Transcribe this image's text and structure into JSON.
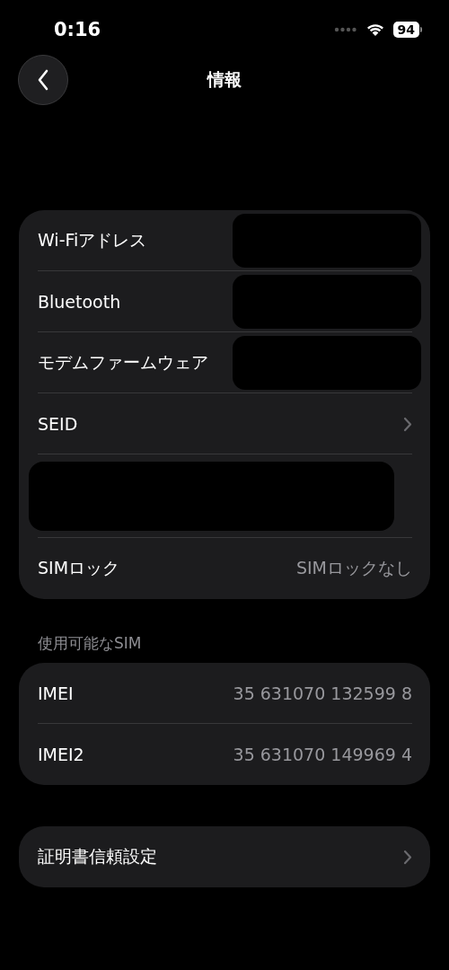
{
  "status_bar": {
    "time": "0:16",
    "battery": "94"
  },
  "nav": {
    "title": "情報"
  },
  "groups": [
    {
      "rows": [
        {
          "kind": "item",
          "label": "Wi-Fiアドレス",
          "chevron": false,
          "redacted": true
        },
        {
          "kind": "item",
          "label": "Bluetooth",
          "chevron": false,
          "redacted": true
        },
        {
          "kind": "item",
          "label": "モデムファームウェア",
          "chevron": false,
          "redacted": true
        },
        {
          "kind": "item",
          "label": "SEID",
          "chevron": true,
          "redacted": false
        },
        {
          "kind": "redacted"
        },
        {
          "kind": "item",
          "label": "SIMロック",
          "value": "SIMロックなし",
          "chevron": false,
          "redacted": false
        }
      ]
    },
    {
      "header": "使用可能なSIM",
      "rows": [
        {
          "kind": "item",
          "label": "IMEI",
          "value": "35 631070 132599 8",
          "chevron": false,
          "redacted": false
        },
        {
          "kind": "item",
          "label": "IMEI2",
          "value": "35 631070 149969 4",
          "chevron": false,
          "redacted": false
        }
      ]
    },
    {
      "rows": [
        {
          "kind": "item",
          "label": "証明書信頼設定",
          "chevron": true,
          "redacted": false
        }
      ]
    }
  ]
}
